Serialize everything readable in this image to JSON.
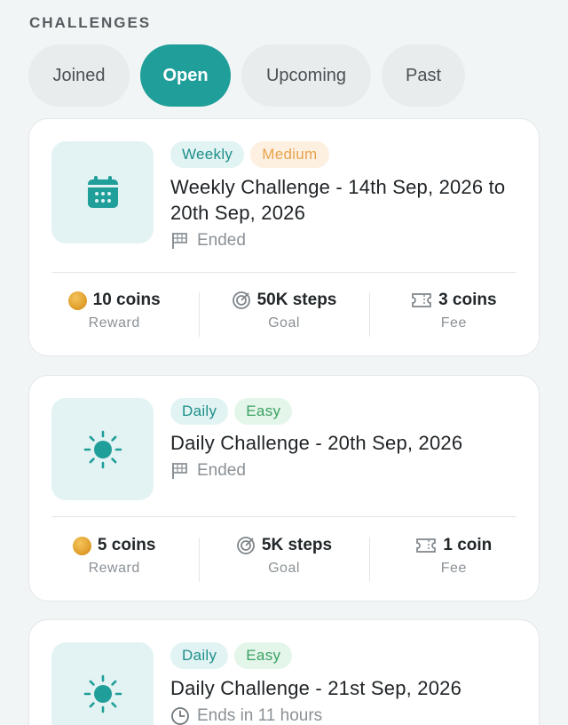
{
  "header": {
    "title": "CHALLENGES"
  },
  "tabs": [
    {
      "label": "Joined",
      "active": false
    },
    {
      "label": "Open",
      "active": true
    },
    {
      "label": "Upcoming",
      "active": false
    },
    {
      "label": "Past",
      "active": false
    }
  ],
  "cards": [
    {
      "icon": "calendar-icon",
      "badges": [
        "Weekly",
        "Medium"
      ],
      "title": "Weekly Challenge - 14th Sep, 2026 to 20th Sep, 2026",
      "status_icon": "flag-icon",
      "status": "Ended",
      "stats": [
        {
          "icon": "coin-icon",
          "value": "10 coins",
          "label": "Reward"
        },
        {
          "icon": "target-icon",
          "value": "50K steps",
          "label": "Goal"
        },
        {
          "icon": "ticket-icon",
          "value": "3 coins",
          "label": "Fee"
        }
      ]
    },
    {
      "icon": "sun-icon",
      "badges": [
        "Daily",
        "Easy"
      ],
      "title": "Daily Challenge - 20th Sep, 2026",
      "status_icon": "flag-icon",
      "status": "Ended",
      "stats": [
        {
          "icon": "coin-icon",
          "value": "5 coins",
          "label": "Reward"
        },
        {
          "icon": "target-icon",
          "value": "5K steps",
          "label": "Goal"
        },
        {
          "icon": "ticket-icon",
          "value": "1 coin",
          "label": "Fee"
        }
      ]
    },
    {
      "icon": "sun-icon",
      "badges": [
        "Daily",
        "Easy"
      ],
      "title": "Daily Challenge - 21st Sep, 2026",
      "status_icon": "clock-icon",
      "status": "Ends in 11 hours"
    }
  ],
  "colors": {
    "accent": "#1f9e9a",
    "badge_weekly": "#1f8f8b",
    "badge_medium": "#e8a24c",
    "badge_easy": "#3ba263"
  }
}
